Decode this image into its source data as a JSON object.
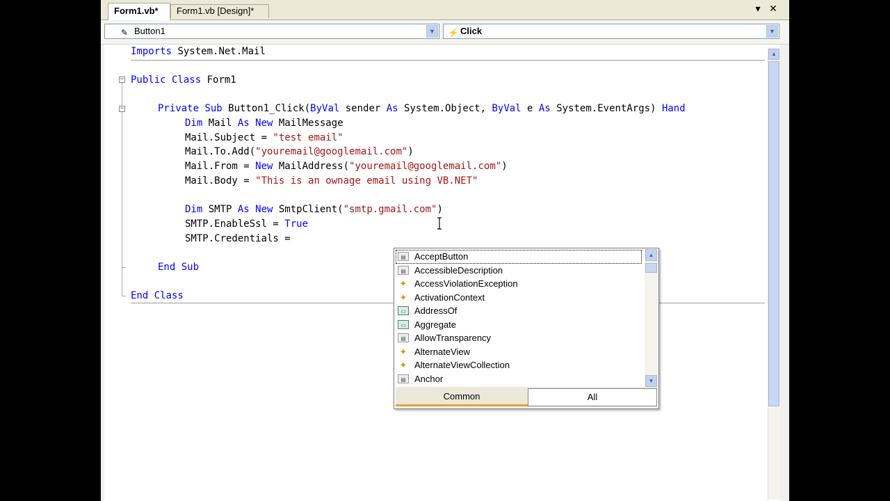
{
  "tabs": [
    {
      "label": "Form1.vb*"
    },
    {
      "label": "Form1.vb [Design]*"
    }
  ],
  "tab_controls": {
    "dropdown": "▾",
    "close": "✕"
  },
  "navbar": {
    "class_name": "Button1",
    "member_name": "Click"
  },
  "code": {
    "l1a": "Imports",
    "l1b": " System.Net.Mail",
    "l2a": "Public Class",
    "l2b": " Form1",
    "l3a": "Private Sub",
    "l3b": " Button1_Click(",
    "l3c": "ByVal",
    "l3d": " sender ",
    "l3e": "As",
    "l3f": " System.Object, ",
    "l3g": "ByVal",
    "l3h": " e ",
    "l3i": "As",
    "l3j": " System.EventArgs) ",
    "l3k": "Hand",
    "l4a": "Dim",
    "l4b": " Mail ",
    "l4c": "As New",
    "l4d": " MailMessage",
    "l5a": "Mail.Subject = ",
    "l5b": "\"test email\"",
    "l6a": "Mail.To.Add(",
    "l6b": "\"youremail@googlemail.com\"",
    "l6c": ")",
    "l7a": "Mail.From = ",
    "l7b": "New",
    "l7c": " MailAddress(",
    "l7d": "\"youremail@googlemail.com\"",
    "l7e": ")",
    "l8a": "Mail.Body = ",
    "l8b": "\"This is an ownage email using VB.NET\"",
    "l9a": "Dim",
    "l9b": " SMTP ",
    "l9c": "As New",
    "l9d": " SmtpClient(",
    "l9e": "\"smtp.gmail.com\"",
    "l9f": ")",
    "l10a": "SMTP.EnableSsl = ",
    "l10b": "True",
    "l11a": "SMTP.Credentials =",
    "l12a": "End Sub",
    "l13a": "End Class"
  },
  "intellisense": {
    "items": [
      {
        "label": "AcceptButton",
        "icon": "property-icon"
      },
      {
        "label": "AccessibleDescription",
        "icon": "property-icon"
      },
      {
        "label": "AccessViolationException",
        "icon": "class-icon"
      },
      {
        "label": "ActivationContext",
        "icon": "class-icon"
      },
      {
        "label": "AddressOf",
        "icon": "keyword-icon"
      },
      {
        "label": "Aggregate",
        "icon": "keyword-icon"
      },
      {
        "label": "AllowTransparency",
        "icon": "property-icon"
      },
      {
        "label": "AlternateView",
        "icon": "class-icon"
      },
      {
        "label": "AlternateViewCollection",
        "icon": "class-icon"
      },
      {
        "label": "Anchor",
        "icon": "property-icon"
      }
    ],
    "tab_common": "Common",
    "tab_all": "All"
  },
  "colors": {
    "keyword": "#0000ff",
    "string": "#a31515",
    "text": "#000000"
  }
}
